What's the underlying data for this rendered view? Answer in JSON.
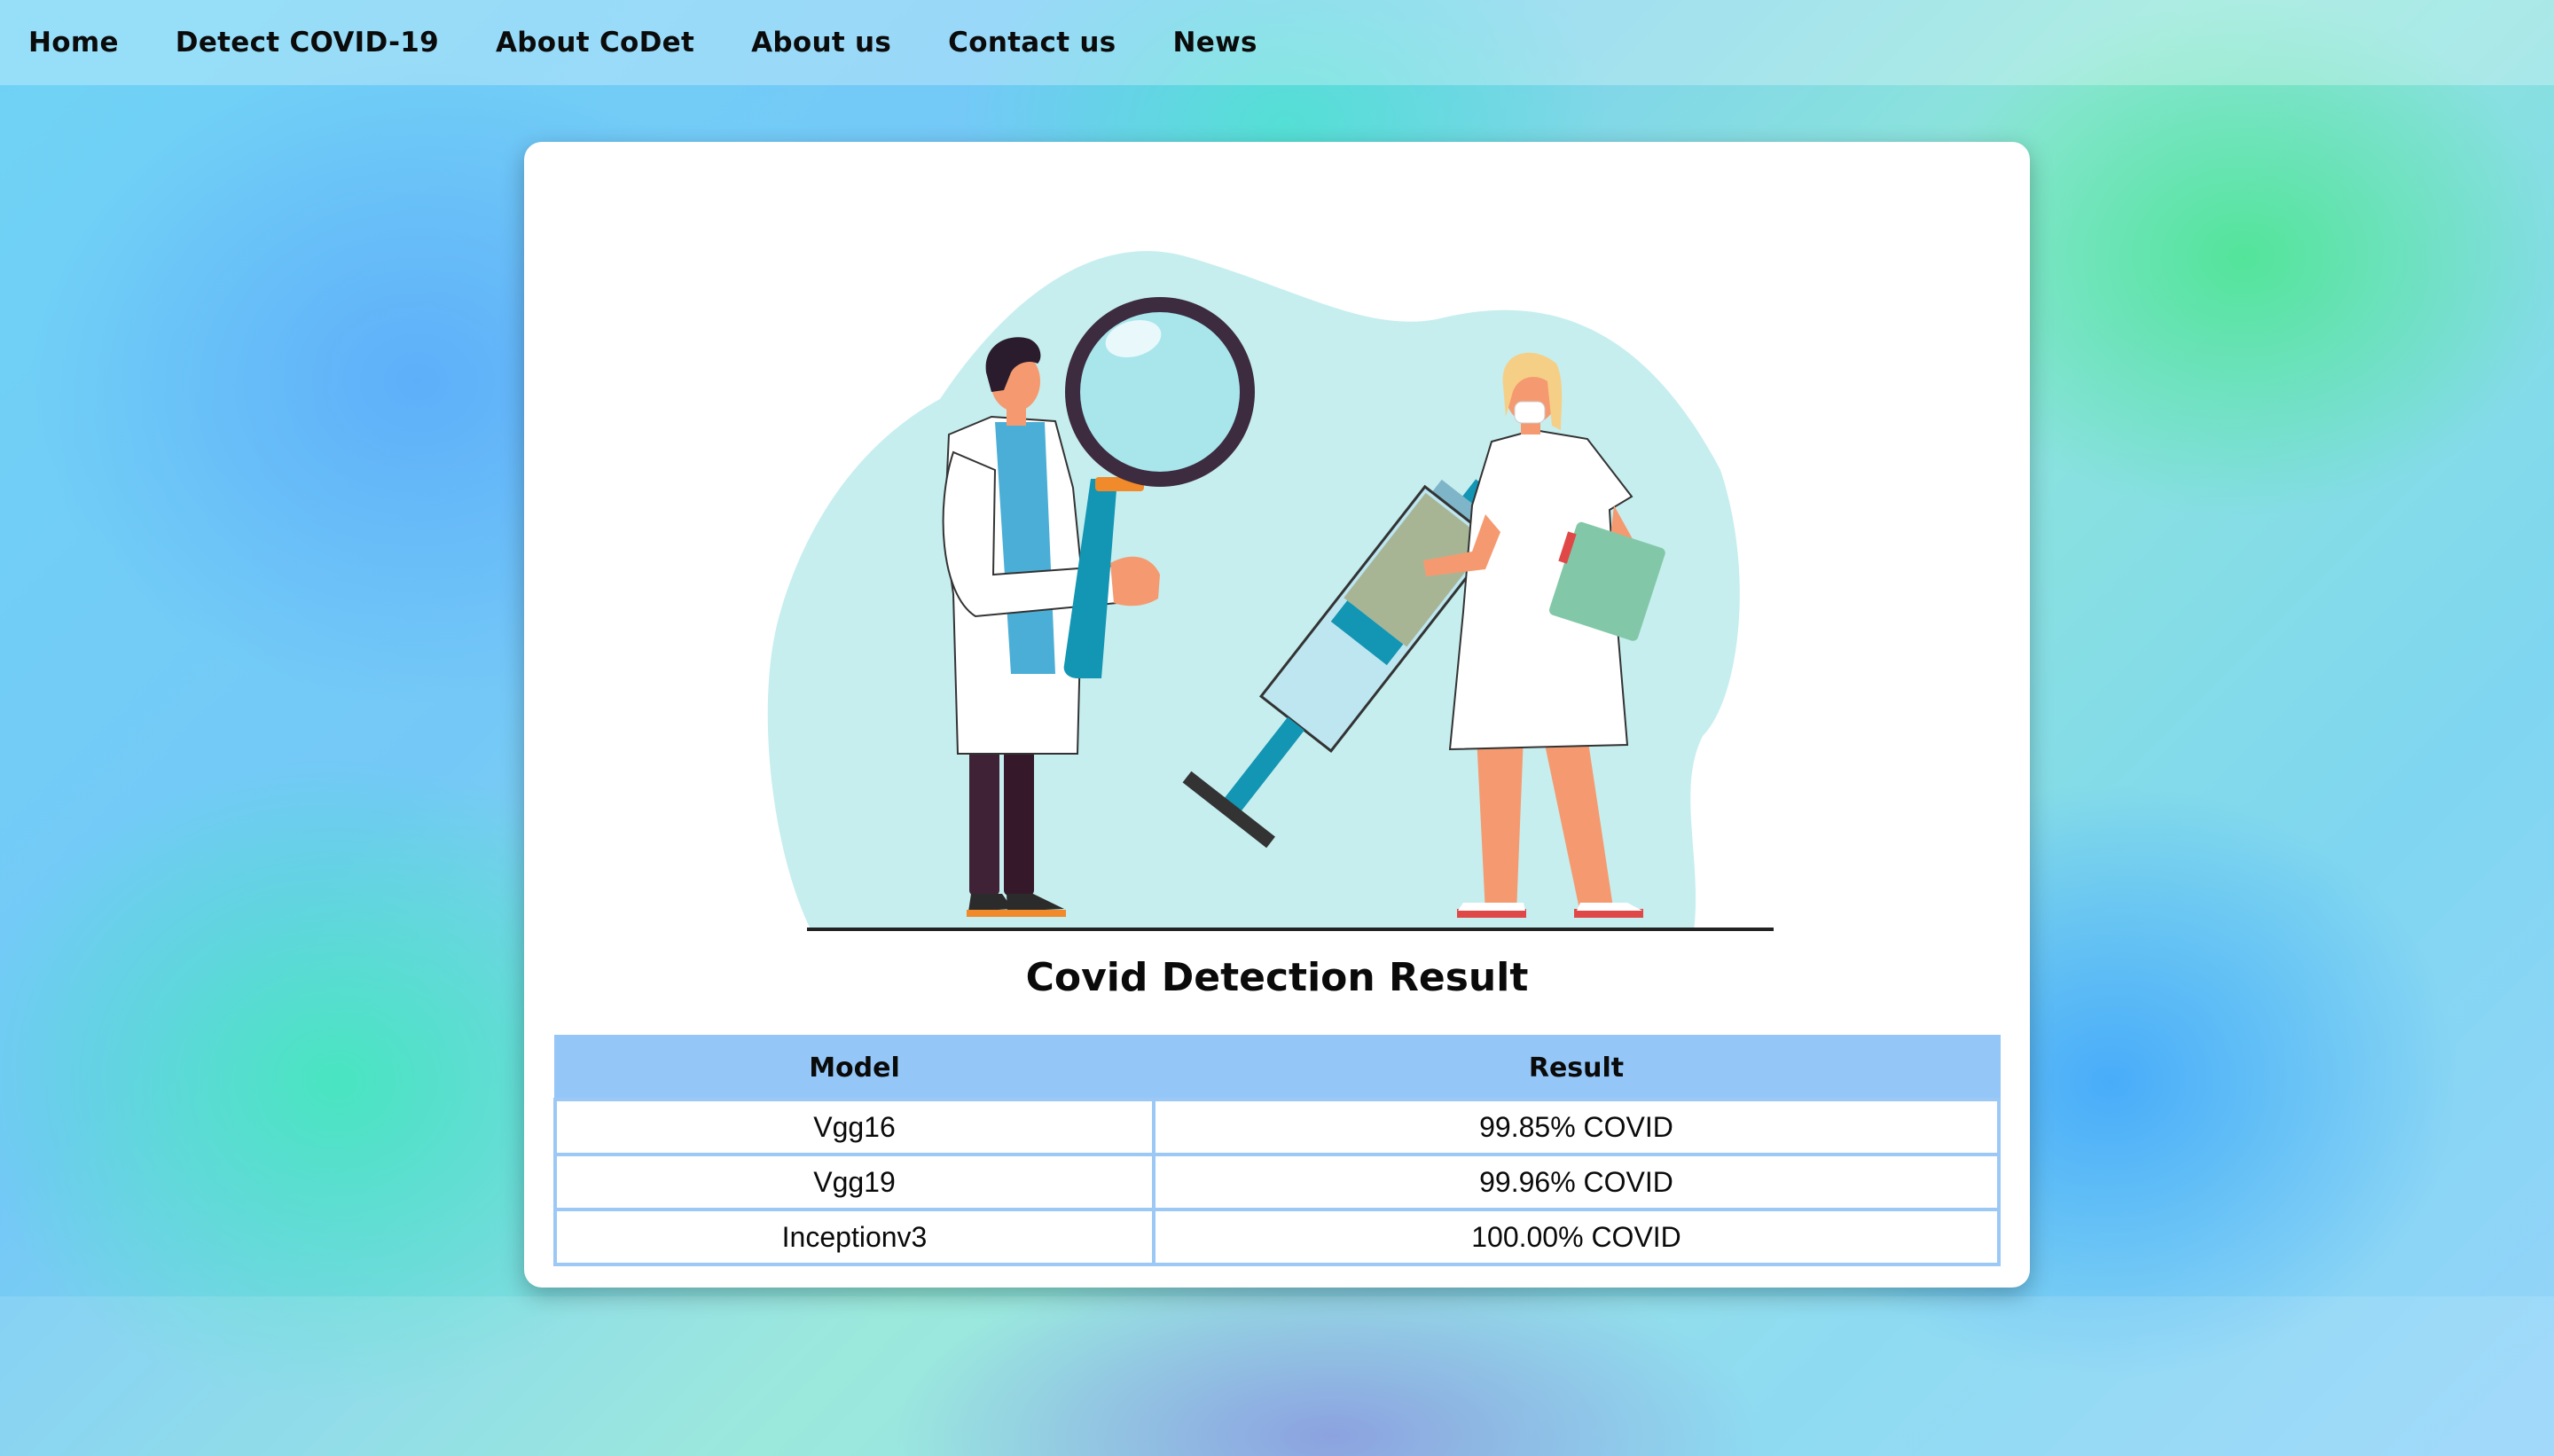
{
  "nav": {
    "items": [
      "Home",
      "Detect COVID-19",
      "About CoDet",
      "About us",
      "Contact us",
      "News"
    ]
  },
  "main": {
    "title": "Covid Detection Result",
    "table": {
      "headers": [
        "Model",
        "Result"
      ],
      "rows": [
        [
          "Vgg16",
          "99.85% COVID"
        ],
        [
          "Vgg19",
          "99.96% COVID"
        ],
        [
          "Inceptionv3",
          "100.00% COVID"
        ]
      ]
    }
  },
  "colors": {
    "table_header": "#94c6f8",
    "table_border": "#9cc8f5",
    "blob": "#c6eeee"
  }
}
